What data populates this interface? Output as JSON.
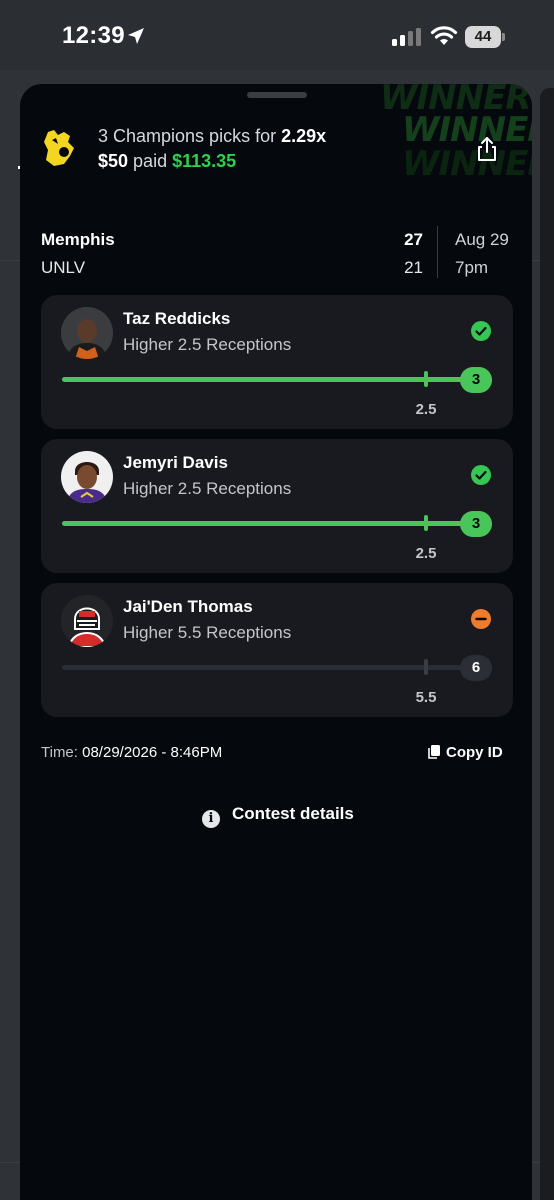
{
  "status_bar": {
    "time": "12:39",
    "battery": "44"
  },
  "summary": {
    "picks_text": "3 Champions picks for ",
    "multiplier": "2.29x",
    "stake": "$50",
    "paid_label": " paid ",
    "payout": "$113.35",
    "banner_text": "WINNER!!"
  },
  "game": {
    "team1": "Memphis",
    "team1_score": "27",
    "team2": "UNLV",
    "team2_score": "21",
    "date": "Aug 29",
    "time": "7pm"
  },
  "picks": [
    {
      "name": "Taz Reddicks",
      "line": "Higher 2.5 Receptions",
      "threshold": "2.5",
      "result": "3",
      "status": "win",
      "progress": 1.0
    },
    {
      "name": "Jemyri Davis",
      "line": "Higher 2.5 Receptions",
      "threshold": "2.5",
      "result": "3",
      "status": "win",
      "progress": 1.0
    },
    {
      "name": "Jai'Den Thomas",
      "line": "Higher 5.5 Receptions",
      "threshold": "5.5",
      "result": "6",
      "status": "push",
      "progress": 0.0
    }
  ],
  "footer": {
    "time_label": "Time:",
    "time_value": "08/29/2026 - 8:46PM",
    "copy_label": "Copy ID",
    "contest_label": "Contest details"
  },
  "colors": {
    "win": "#49c65a",
    "payout": "#2fd04e",
    "push": "#f07b2b",
    "background": "#05080d"
  }
}
